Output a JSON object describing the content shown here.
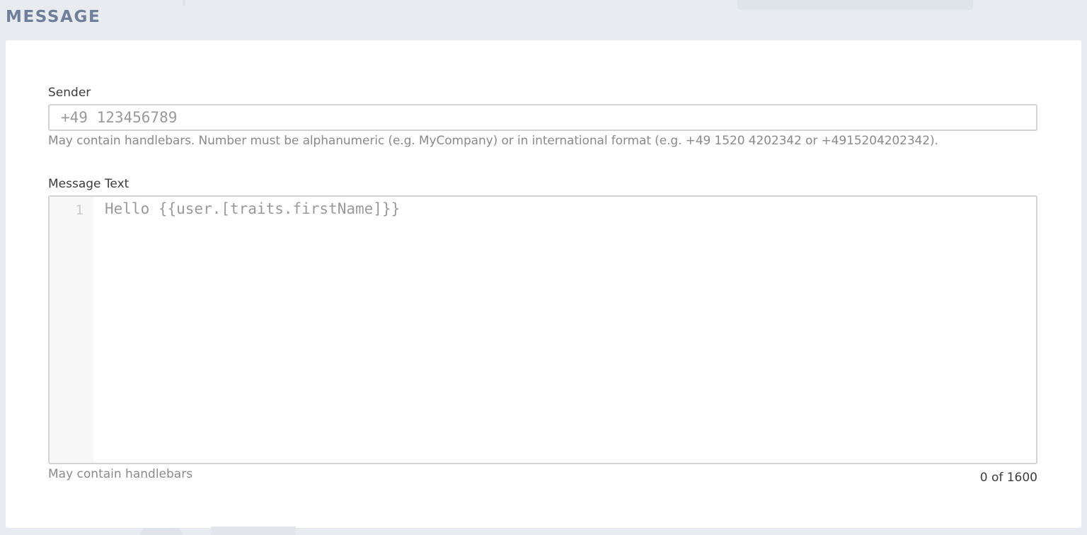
{
  "section": {
    "title": "MESSAGE"
  },
  "sender": {
    "label": "Sender",
    "placeholder": "+49 123456789",
    "value": "",
    "help": "May contain handlebars. Number must be alphanumeric (e.g. MyCompany) or in international format (e.g. +49 1520 4202342 or +4915204202342)."
  },
  "message_text": {
    "label": "Message Text",
    "line_number": "1",
    "placeholder": "Hello {{user.[traits.firstName]}}",
    "help": "May contain handlebars",
    "char_count": "0 of 1600"
  }
}
